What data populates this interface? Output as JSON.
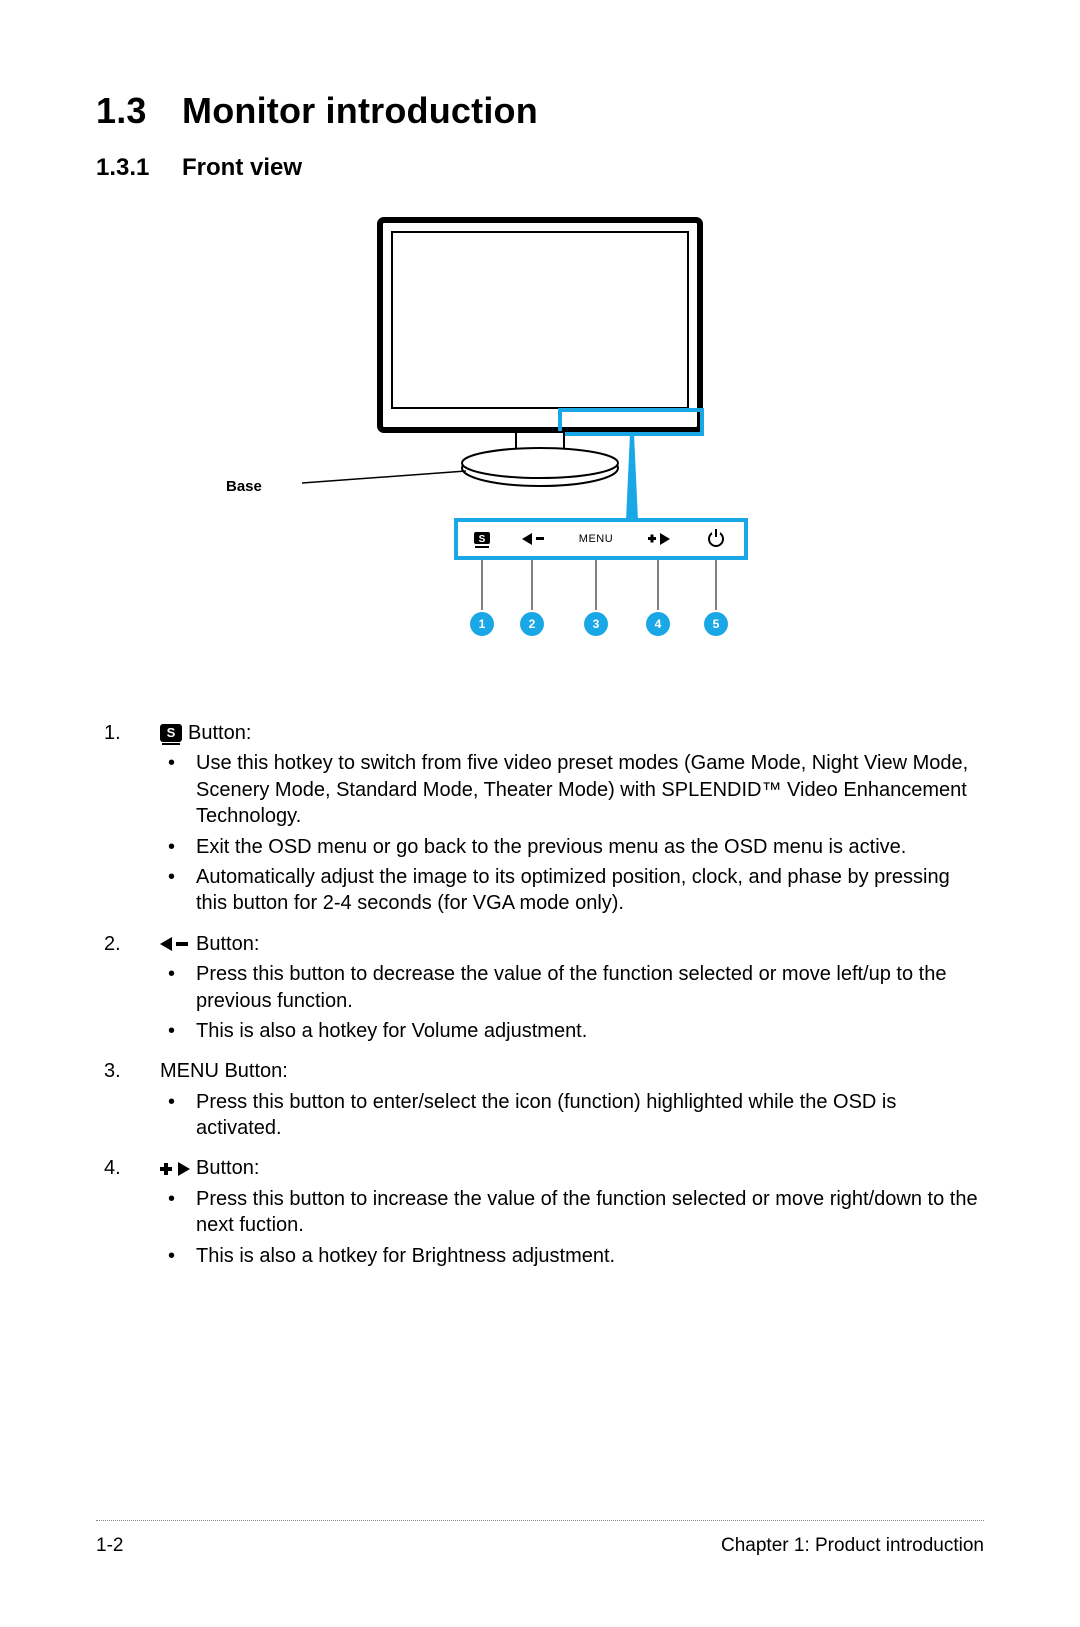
{
  "heading": {
    "num": "1.3",
    "title": "Monitor introduction"
  },
  "subheading": {
    "num": "1.3.1",
    "title": "Front view"
  },
  "diagram": {
    "base_label": "Base",
    "panel_labels": {
      "s": "S",
      "menu": "MENU"
    },
    "callouts": [
      "1",
      "2",
      "3",
      "4",
      "5"
    ]
  },
  "items": [
    {
      "label_suffix": "Button:",
      "bullets": [
        "Use this hotkey to switch from five video preset modes (Game Mode, Night View Mode, Scenery Mode, Standard Mode, Theater Mode) with SPLENDID™ Video Enhancement Technology.",
        "Exit the OSD menu or go back to the previous menu as the OSD menu is active.",
        "Automatically adjust the image to its optimized position, clock, and phase by pressing this button for 2-4 seconds (for VGA mode only)."
      ]
    },
    {
      "label_suffix": "Button:",
      "bullets": [
        "Press this button to decrease the value of the function selected or move left/up to the previous function.",
        "This is also a hotkey for Volume adjustment."
      ]
    },
    {
      "label_text": "MENU Button:",
      "bullets": [
        "Press this button to enter/select the icon (function) highlighted while the OSD is activated."
      ]
    },
    {
      "label_suffix": "Button:",
      "bullets": [
        "Press this button to increase the value of the function selected or move right/down to the next fuction.",
        "This is also a hotkey for Brightness adjustment."
      ]
    }
  ],
  "footer": {
    "page": "1-2",
    "chapter": "Chapter 1: Product introduction"
  }
}
